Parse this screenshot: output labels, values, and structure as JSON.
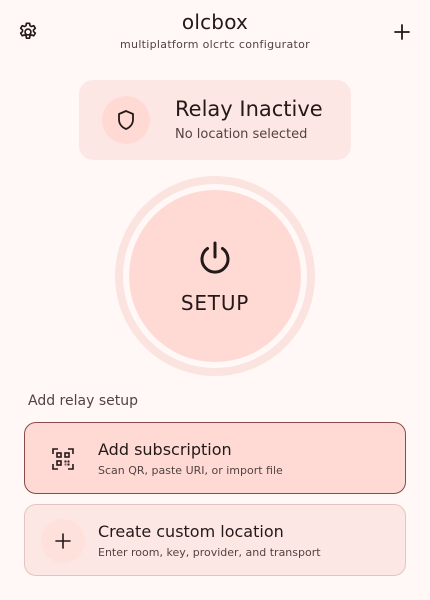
{
  "header": {
    "title": "olcbox",
    "subtitle": "multiplatform olcrtc configurator",
    "settings_icon": "gear-icon",
    "add_icon": "plus-icon"
  },
  "status": {
    "title": "Relay Inactive",
    "subtitle": "No location selected",
    "icon": "shield-icon"
  },
  "power": {
    "label": "SETUP",
    "icon": "power-icon"
  },
  "section": {
    "label": "Add relay setup"
  },
  "actions": [
    {
      "title": "Add subscription",
      "description": "Scan QR, paste URI, or import file",
      "icon": "qr-scan-icon"
    },
    {
      "title": "Create custom location",
      "description": "Enter room, key, provider, and transport",
      "icon": "plus-icon"
    }
  ],
  "colors": {
    "background": "#fff8f6",
    "primary_container": "#ffdad5",
    "surface_container": "#fde7e4",
    "outline_accent": "#8a4a47",
    "on_surface": "#231918"
  }
}
